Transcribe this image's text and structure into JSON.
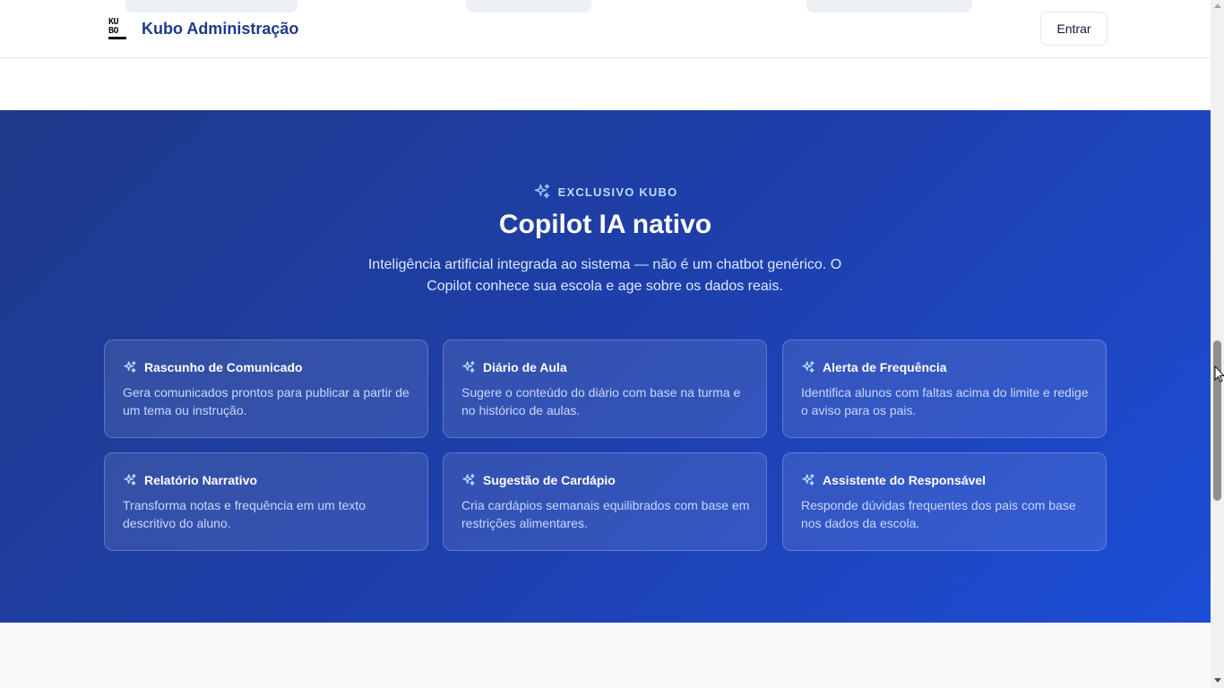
{
  "header": {
    "brand_logo_top": "KU",
    "brand_logo_bottom": "BO",
    "brand_name": "Kubo Administração",
    "login_label": "Entrar"
  },
  "copilot": {
    "eyebrow": "EXCLUSIVO KUBO",
    "title": "Copilot IA nativo",
    "subtitle": "Inteligência artificial integrada ao sistema — não é um chatbot genérico. O Copilot conhece sua escola e age sobre os dados reais.",
    "features": [
      {
        "title": "Rascunho de Comunicado",
        "description": "Gera comunicados prontos para publicar a partir de um tema ou instrução.",
        "icon": "sparkles-icon"
      },
      {
        "title": "Diário de Aula",
        "description": "Sugere o conteúdo do diário com base na turma e no histórico de aulas.",
        "icon": "sparkles-icon"
      },
      {
        "title": "Alerta de Frequência",
        "description": "Identifica alunos com faltas acima do limite e redige o aviso para os pais.",
        "icon": "sparkles-icon"
      },
      {
        "title": "Relatório Narrativo",
        "description": "Transforma notas e frequência em um texto descritivo do aluno.",
        "icon": "sparkles-icon"
      },
      {
        "title": "Sugestão de Cardápio",
        "description": "Cria cardápios semanais equilibrados com base em restrições alimentares.",
        "icon": "sparkles-icon"
      },
      {
        "title": "Assistente do Responsável",
        "description": "Responde dúvidas frequentes dos pais com base nos dados da escola.",
        "icon": "sparkles-icon"
      }
    ]
  },
  "colors": {
    "brand": "#1e3a8a",
    "section_gradient_start": "#1e3a8a",
    "section_gradient_end": "#1d4ed8",
    "eyebrow": "#bfdbfe"
  }
}
